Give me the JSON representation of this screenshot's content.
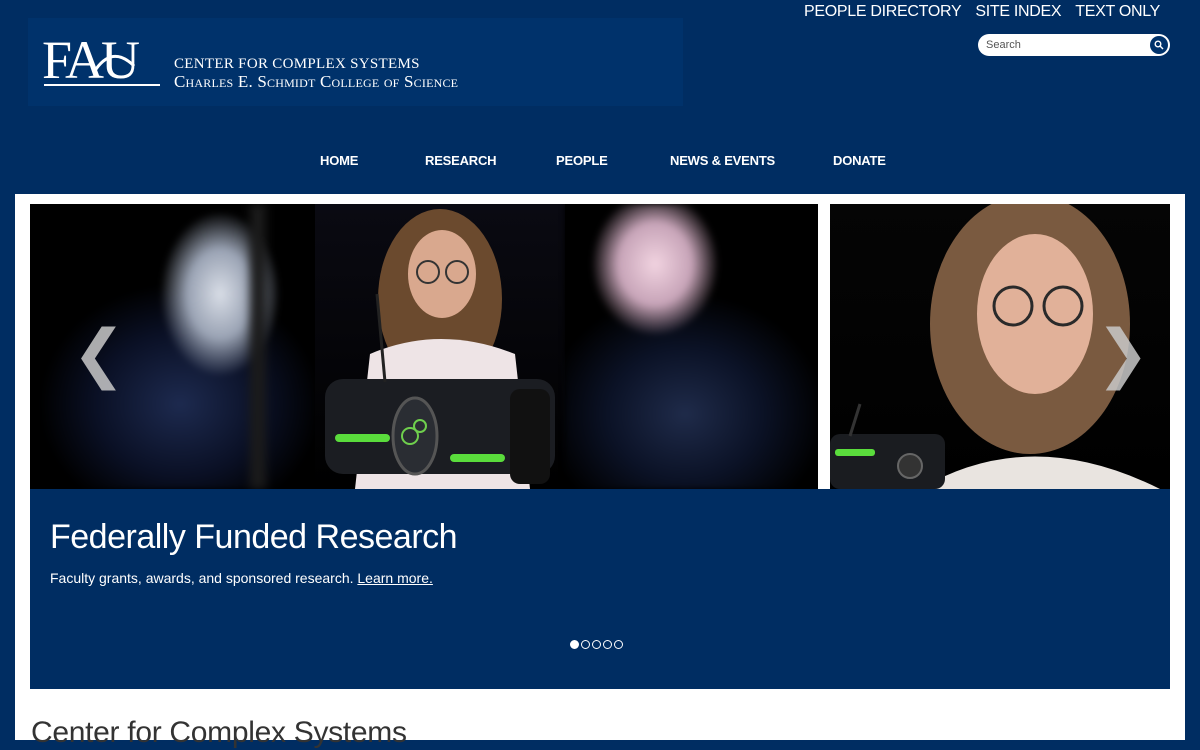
{
  "header": {
    "logo_text": "FAU",
    "center_name": "CENTER FOR COMPLEX SYSTEMS",
    "college_name": "Charles E. Schmidt College of Science",
    "util_links": [
      "PEOPLE DIRECTORY",
      "SITE INDEX",
      "TEXT ONLY"
    ],
    "search_placeholder": "Search"
  },
  "nav": [
    "HOME",
    "RESEARCH",
    "PEOPLE",
    "NEWS & EVENTS",
    "DONATE"
  ],
  "slider": {
    "prev_arrow": "❮",
    "next_arrow": "❯",
    "title": "Federally Funded Research",
    "text": "Faculty grants, awards, and sponsored research.",
    "link_text": "Learn more.",
    "total_slides": 5,
    "active_slide": 1
  },
  "main": {
    "heading": "Center for Complex Systems"
  },
  "colors": {
    "brand_navy": "#002d62",
    "logo_bg": "#00326b"
  }
}
